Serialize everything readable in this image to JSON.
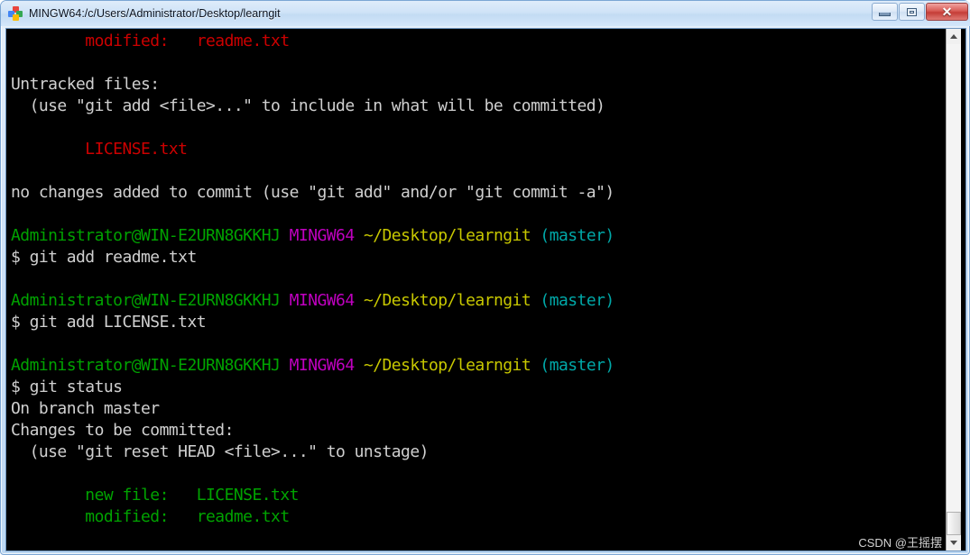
{
  "window": {
    "title": "MINGW64:/c/Users/Administrator/Desktop/learngit",
    "icon": "git-bash-icon",
    "controls": {
      "minimize_label": "–",
      "maximize_label": "❐",
      "close_label": "✕"
    }
  },
  "colors": {
    "background": "#000000",
    "default_text": "#d0d0d0",
    "red": "#cc0000",
    "green": "#00a300",
    "magenta": "#c000c0",
    "yellow": "#c8c800",
    "cyan": "#00a8a8",
    "titlebar": "#cfe3f7",
    "close_button": "#c43d37"
  },
  "scrollbar": {
    "up_arrow": "arrow-up-icon",
    "down_arrow": "arrow-down-icon",
    "thumb_position": "bottom"
  },
  "watermark": "CSDN @王摇摆",
  "terminal": {
    "lines": [
      {
        "segments": [
          {
            "text": "        modified:   readme.txt",
            "color": "red"
          }
        ]
      },
      {
        "segments": [
          {
            "text": "",
            "color": "white"
          }
        ]
      },
      {
        "segments": [
          {
            "text": "Untracked files:",
            "color": "white"
          }
        ]
      },
      {
        "segments": [
          {
            "text": "  (use \"git add <file>...\" to include in what will be committed)",
            "color": "white"
          }
        ]
      },
      {
        "segments": [
          {
            "text": "",
            "color": "white"
          }
        ]
      },
      {
        "segments": [
          {
            "text": "        LICENSE.txt",
            "color": "red"
          }
        ]
      },
      {
        "segments": [
          {
            "text": "",
            "color": "white"
          }
        ]
      },
      {
        "segments": [
          {
            "text": "no changes added to commit (use \"git add\" and/or \"git commit -a\")",
            "color": "white"
          }
        ]
      },
      {
        "segments": [
          {
            "text": "",
            "color": "white"
          }
        ]
      },
      {
        "segments": [
          {
            "text": "Administrator@WIN-E2URN8GKKHJ",
            "color": "green"
          },
          {
            "text": " ",
            "color": "white"
          },
          {
            "text": "MINGW64",
            "color": "magenta"
          },
          {
            "text": " ",
            "color": "white"
          },
          {
            "text": "~/Desktop/learngit",
            "color": "yellow"
          },
          {
            "text": " ",
            "color": "white"
          },
          {
            "text": "(master)",
            "color": "cyan"
          }
        ]
      },
      {
        "segments": [
          {
            "text": "$ git add readme.txt",
            "color": "white"
          }
        ]
      },
      {
        "segments": [
          {
            "text": "",
            "color": "white"
          }
        ]
      },
      {
        "segments": [
          {
            "text": "Administrator@WIN-E2URN8GKKHJ",
            "color": "green"
          },
          {
            "text": " ",
            "color": "white"
          },
          {
            "text": "MINGW64",
            "color": "magenta"
          },
          {
            "text": " ",
            "color": "white"
          },
          {
            "text": "~/Desktop/learngit",
            "color": "yellow"
          },
          {
            "text": " ",
            "color": "white"
          },
          {
            "text": "(master)",
            "color": "cyan"
          }
        ]
      },
      {
        "segments": [
          {
            "text": "$ git add LICENSE.txt",
            "color": "white"
          }
        ]
      },
      {
        "segments": [
          {
            "text": "",
            "color": "white"
          }
        ]
      },
      {
        "segments": [
          {
            "text": "Administrator@WIN-E2URN8GKKHJ",
            "color": "green"
          },
          {
            "text": " ",
            "color": "white"
          },
          {
            "text": "MINGW64",
            "color": "magenta"
          },
          {
            "text": " ",
            "color": "white"
          },
          {
            "text": "~/Desktop/learngit",
            "color": "yellow"
          },
          {
            "text": " ",
            "color": "white"
          },
          {
            "text": "(master)",
            "color": "cyan"
          }
        ]
      },
      {
        "segments": [
          {
            "text": "$ git status",
            "color": "white"
          }
        ]
      },
      {
        "segments": [
          {
            "text": "On branch master",
            "color": "white"
          }
        ]
      },
      {
        "segments": [
          {
            "text": "Changes to be committed:",
            "color": "white"
          }
        ]
      },
      {
        "segments": [
          {
            "text": "  (use \"git reset HEAD <file>...\" to unstage)",
            "color": "white"
          }
        ]
      },
      {
        "segments": [
          {
            "text": "",
            "color": "white"
          }
        ]
      },
      {
        "segments": [
          {
            "text": "        new file:   LICENSE.txt",
            "color": "green"
          }
        ]
      },
      {
        "segments": [
          {
            "text": "        modified:   readme.txt",
            "color": "green"
          }
        ]
      }
    ]
  }
}
